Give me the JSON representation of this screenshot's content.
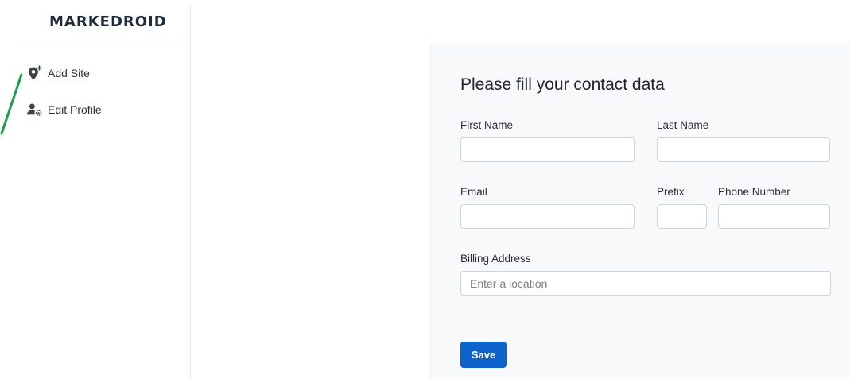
{
  "sidebar": {
    "brand": "MARKEDROID",
    "items": [
      {
        "label": "Add Site",
        "icon": "map-pin-plus-icon"
      },
      {
        "label": "Edit Profile",
        "icon": "user-settings-icon"
      }
    ]
  },
  "form": {
    "title": "Please fill your contact data",
    "first_name": {
      "label": "First Name",
      "value": "",
      "placeholder": ""
    },
    "last_name": {
      "label": "Last Name",
      "value": "",
      "placeholder": ""
    },
    "email": {
      "label": "Email",
      "value": "",
      "placeholder": ""
    },
    "prefix": {
      "label": "Prefix",
      "value": "",
      "placeholder": ""
    },
    "phone": {
      "label": "Phone Number",
      "value": "",
      "placeholder": ""
    },
    "billing": {
      "label": "Billing Address",
      "value": "",
      "placeholder": "Enter a location"
    },
    "save_label": "Save"
  },
  "colors": {
    "primary_button": "#0d63c9",
    "accent_line": "#1a9e4b",
    "card_background": "#f8f9fa"
  }
}
